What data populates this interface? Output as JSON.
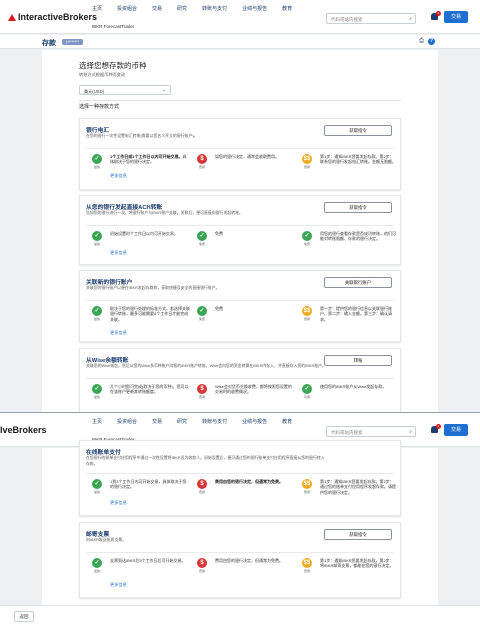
{
  "header": {
    "brand_a": "InteractiveBrokers",
    "brand_b": "lveBrokers",
    "nav": [
      "主页",
      "投资组合",
      "交易",
      "研究",
      "转账与支付",
      "业绩与报告",
      "教育"
    ],
    "subnav": "IBKR ForecastTrader",
    "search_placeholder": "代码或站内搜索",
    "notification_count": "1",
    "login": "交易"
  },
  "page": {
    "title": "存款",
    "badge": "U*******",
    "currency_heading": "选择您想存款的币种",
    "currency_hint": "转账方式根据币种而变动",
    "currency_value": "美元(USD)",
    "method_heading": "选择一种存款方式"
  },
  "cards": [
    {
      "title": "银行电汇",
      "desc": "在您的银行一次性设置电汇转账(需要以您名义开立的银行账户)。",
      "button": "获取指令",
      "col1": {
        "icon": "check",
        "label": "最快",
        "text_bold": "1个工作日或1个工作日以内可开始交易。",
        "text": "具体取决于您的银行决定。"
      },
      "col2": {
        "icon": "dollar",
        "label": "费用",
        "text": "如您的银行决定，通常会收取费用。"
      },
      "col3": {
        "icon": "dollar",
        "label": "费用",
        "text": "第1步：通知IBKR您要发起存款。第2步：联系您的银行发起电汇转账。金额无限额。"
      },
      "more": "更多信息"
    },
    {
      "title": "从您的银行发起直接ACH转账",
      "desc": "告知您的银行进行一次，将银行账户与IBKR账户关联。关联后，便可直接向银行发起转账。",
      "button": "获取指令",
      "col1": {
        "icon": "check",
        "label": "最快",
        "text": "初始设置时个工作日以内可开始交易。"
      },
      "col2": {
        "icon": "check",
        "label": "免费",
        "text": "免费"
      },
      "col3": {
        "icon": "check",
        "label": "免费",
        "text": "用您的银行查看存款是否成功转账，他们可能对转账限额、存款的银行决定。"
      },
      "more": "更多信息"
    },
    {
      "title": "关联新的银行账户",
      "desc": "关联您的银行账户以便在IBKR发起存取款，获取快捷及安全的直接银行账户。",
      "button": "关联银行账户",
      "col1": {
        "icon": "check",
        "label": "最快",
        "text": "取决于您的银行处理的标准方式，若选择关联银行转账，最多可能需要4个工作日才能完成关联。"
      },
      "col2": {
        "icon": "check",
        "label": "免费",
        "text": "免费"
      },
      "col3": {
        "icon": "dollar",
        "label": "费用",
        "text": "第一步：提供您的银行信息以关联银行账户。第二步：输入金额。第三步：确认请求。"
      },
      "more": "更多信息"
    },
    {
      "title": "从Wise余额转账",
      "desc": "关联您的Wise钱包，然后从您的Wise多币种账户向您的IBKR账户转账，Wise会向您的资金转换在IBKR内存入，并直接存入您的IBKR账户。",
      "button": "转账",
      "col1": {
        "icon": "check",
        "label": "最快",
        "text": "几个小时即可完成(取决于您的币种)，您可以在该账户更新其转账额度。"
      },
      "col2": {
        "icon": "dollar",
        "label": "费用",
        "text": "Wise会对货币兑换收费，都将按照您设置的交易时的收费情况。"
      },
      "col3": {
        "icon": "check",
        "label": "可用",
        "text": "使用您的IBKR账户从Wise发起存款。"
      },
      "more": ""
    },
    {
      "title": "在线账单支付",
      "desc": "在您银行的账单支付应用程序中通过一次性设置将IBKR设为收款人。初始设置后，便可通过您的银行账单支付应用程序直接从您的银行转入存款。",
      "button": "",
      "col1": {
        "icon": "check",
        "label": "最快",
        "text": "1到3个工作日内可开始交易，具体取决于您的银行决定。"
      },
      "col2": {
        "icon": "dollar",
        "label": "费用",
        "text_bold": "费用由您的银行决定，但通常为免费。",
        "text": ""
      },
      "col3": {
        "icon": "dollar",
        "label": "费用",
        "text": "第1步：通知IBKR您要发起存款。第2步：通过您的账单支付应用程序发起存款。请提供您的银行决定。"
      },
      "more": "更多信息"
    },
    {
      "title": "邮寄支票",
      "desc": "向IBKR发送纸质支票。",
      "button": "获取指令",
      "col1": {
        "icon": "check",
        "label": "最快",
        "text": "支票到达IBKR后5个工作日后可开始交易。"
      },
      "col2": {
        "icon": "dollar",
        "label": "费用",
        "text": "费用由您的银行决定，但通常为免费。"
      },
      "col3": {
        "icon": "dollar",
        "label": "费用",
        "text": "第1步：通知IBKR您要发起存款。第2步：将IBKR邮寄支票，都能在您的银行决定。"
      },
      "more": "更多信息"
    }
  ],
  "footer": {
    "back": "返回"
  }
}
